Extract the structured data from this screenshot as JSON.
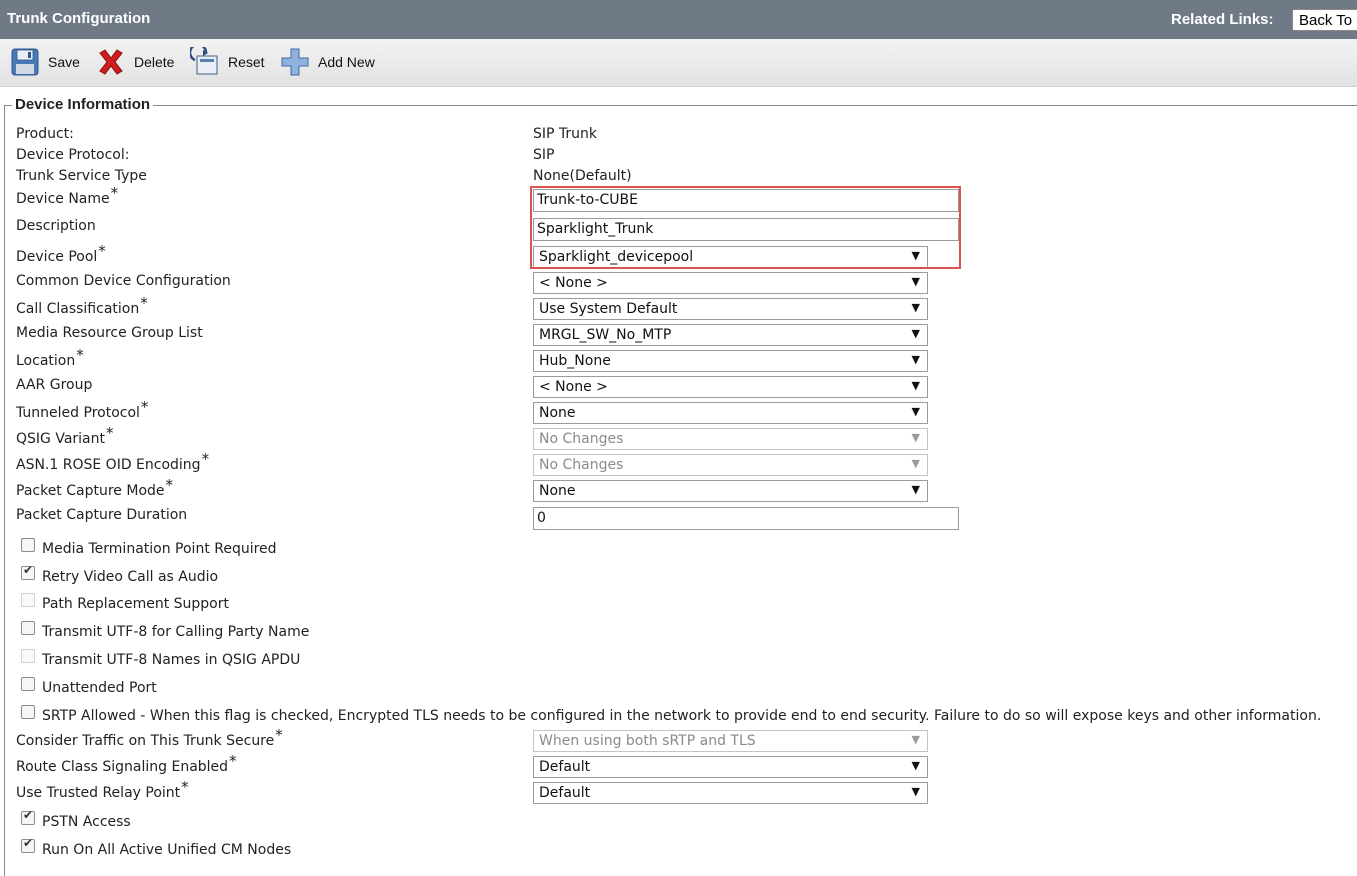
{
  "header": {
    "title": "Trunk Configuration",
    "related_links_label": "Related Links:",
    "related_links_value": "Back To"
  },
  "toolbar": {
    "save": "Save",
    "delete": "Delete",
    "reset": "Reset",
    "add_new": "Add New"
  },
  "section": {
    "legend": "Device Information"
  },
  "info": {
    "product_label": "Product:",
    "product_value": "SIP Trunk",
    "protocol_label": "Device Protocol:",
    "protocol_value": "SIP",
    "service_type_label": "Trunk Service Type",
    "service_type_value": "None(Default)"
  },
  "fields": {
    "device_name": {
      "label": "Device Name",
      "required": "*",
      "value": "Trunk-to-CUBE"
    },
    "description": {
      "label": "Description",
      "value": "Sparklight_Trunk"
    },
    "device_pool": {
      "label": "Device Pool",
      "required": "*",
      "value": "Sparklight_devicepool"
    },
    "common_device_config": {
      "label": "Common Device Configuration",
      "value": "< None >"
    },
    "call_classification": {
      "label": "Call Classification",
      "required": "*",
      "value": "Use System Default"
    },
    "mrgl": {
      "label": "Media Resource Group List",
      "value": "MRGL_SW_No_MTP"
    },
    "location": {
      "label": "Location",
      "required": "*",
      "value": "Hub_None"
    },
    "aar_group": {
      "label": "AAR Group",
      "value": "< None >"
    },
    "tunneled_protocol": {
      "label": "Tunneled Protocol",
      "required": "*",
      "value": "None"
    },
    "qsig_variant": {
      "label": "QSIG Variant",
      "required": "*",
      "value": "No Changes"
    },
    "asn1": {
      "label": "ASN.1 ROSE OID Encoding",
      "required": "*",
      "value": "No Changes"
    },
    "packet_capture_mode": {
      "label": "Packet Capture Mode",
      "required": "*",
      "value": "None"
    },
    "packet_capture_duration": {
      "label": "Packet Capture Duration",
      "value": "0"
    },
    "consider_traffic": {
      "label": "Consider Traffic on This Trunk Secure",
      "required": "*",
      "value": "When using both sRTP and TLS"
    },
    "route_class": {
      "label": "Route Class Signaling Enabled",
      "required": "*",
      "value": "Default"
    },
    "trusted_relay": {
      "label": "Use Trusted Relay Point",
      "required": "*",
      "value": "Default"
    }
  },
  "checkboxes": {
    "mtp_required": {
      "label": "Media Termination Point Required",
      "checked": false
    },
    "retry_video": {
      "label": "Retry Video Call as Audio",
      "checked": true
    },
    "path_replacement": {
      "label": "Path Replacement Support",
      "checked": false
    },
    "utf8_calling": {
      "label": "Transmit UTF-8 for Calling Party Name",
      "checked": false
    },
    "utf8_qsig": {
      "label": "Transmit UTF-8 Names in QSIG APDU",
      "checked": false
    },
    "unattended_port": {
      "label": "Unattended Port",
      "checked": false
    },
    "srtp_allowed": {
      "label": "SRTP Allowed - When this flag is checked, Encrypted TLS needs to be configured in the network to provide end to end security. Failure to do so will expose keys and other information.",
      "checked": false
    },
    "pstn_access": {
      "label": "PSTN Access",
      "checked": true
    },
    "run_on_all_nodes": {
      "label": "Run On All Active Unified CM Nodes",
      "checked": true
    }
  },
  "colors": {
    "header_bg": "#6f7a86",
    "highlight_border": "#d9534f"
  }
}
